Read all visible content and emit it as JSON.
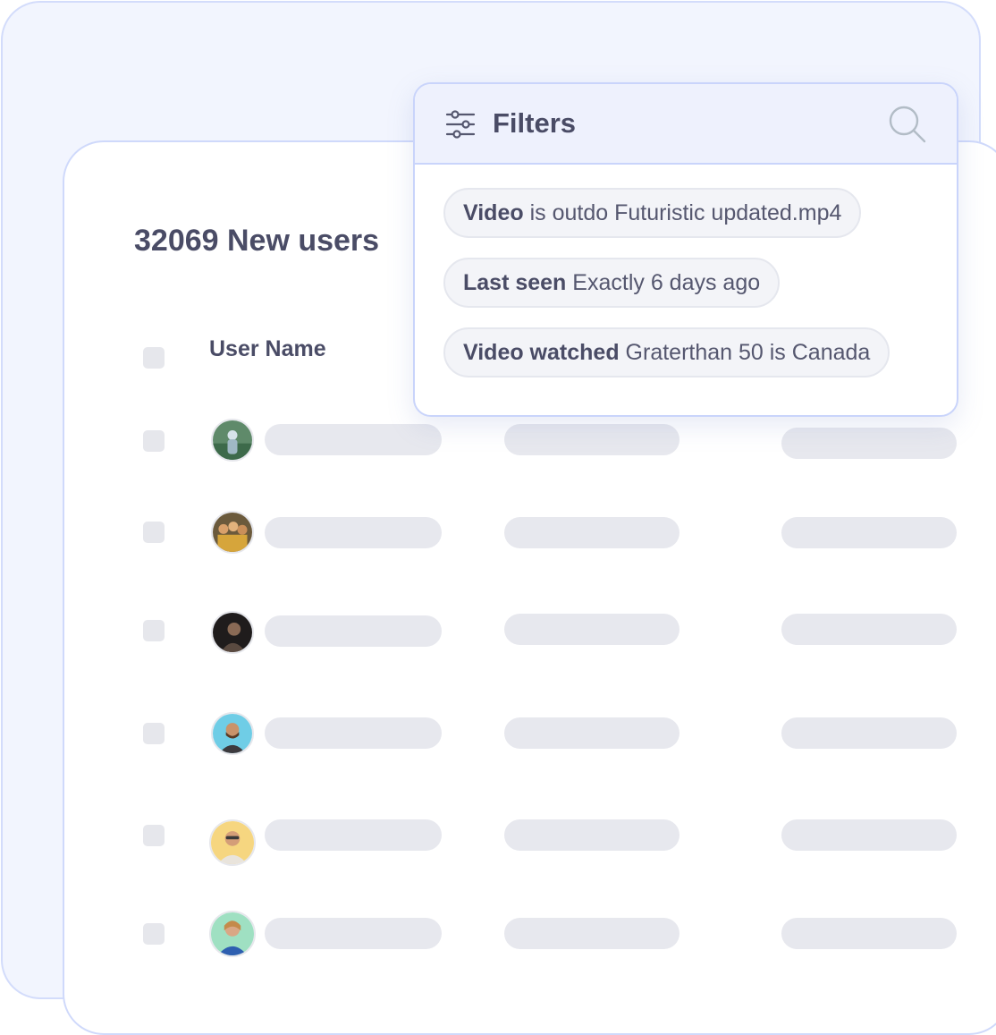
{
  "table": {
    "title": "32069 New users",
    "columns": [
      "User Name"
    ],
    "rows": [
      {
        "avatar": "user-avatar-forest-person"
      },
      {
        "avatar": "user-avatar-group-photo"
      },
      {
        "avatar": "user-avatar-dark-portrait"
      },
      {
        "avatar": "user-avatar-bearded-man"
      },
      {
        "avatar": "user-avatar-man-with-glasses"
      },
      {
        "avatar": "user-avatar-woman-smiling"
      }
    ]
  },
  "filters": {
    "title": "Filters",
    "icons": {
      "filter": "sliders-icon",
      "search": "search-icon"
    },
    "chips": [
      {
        "field": "Video",
        "rest": "is outdo Futuristic updated.mp4"
      },
      {
        "field": "Last seen",
        "rest": "Exactly 6 days ago"
      },
      {
        "field": "Video watched",
        "rest": "Graterthan 50 is Canada"
      }
    ]
  },
  "colors": {
    "background": "#f2f5fe",
    "accent_border": "#c9d4fb",
    "placeholder": "#e7e8ee",
    "text": "#4a4c66"
  }
}
